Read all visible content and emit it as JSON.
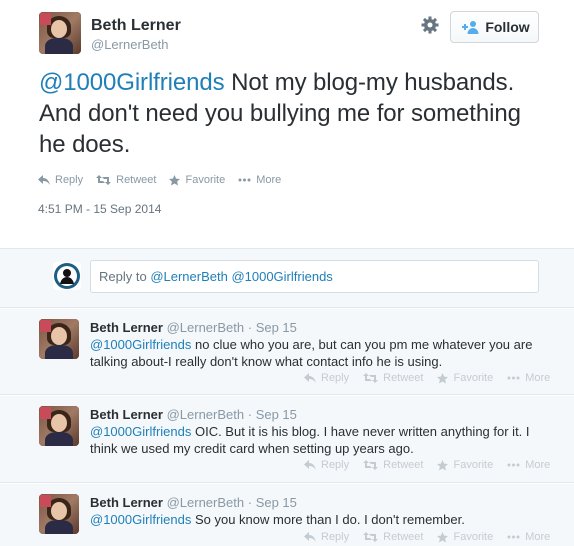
{
  "tweet": {
    "author_name": "Beth Lerner",
    "author_handle": "@LernerBeth",
    "follow_label": "Follow",
    "mention": "@1000Girlfriends",
    "text": " Not my blog-my husbands. And don't need you bullying me for something he does.",
    "actions": {
      "reply": "Reply",
      "retweet": "Retweet",
      "favorite": "Favorite",
      "more": "More"
    },
    "timestamp": "4:51 PM - 15 Sep 2014"
  },
  "reply_box": {
    "prefix": "Reply to ",
    "mentions": "@LernerBeth @1000Girlfriends"
  },
  "replies": [
    {
      "name": "Beth Lerner",
      "handle": "@LernerBeth",
      "date": "Sep 15",
      "mention": "@1000Girlfriends",
      "text": " no clue who you are, but can you pm me whatever you are talking about-I really don't know what contact info he is using."
    },
    {
      "name": "Beth Lerner",
      "handle": "@LernerBeth",
      "date": "Sep 15",
      "mention": "@1000Girlfriends",
      "text": " OIC. But it is his blog. I have never written anything for it. I think we used my credit card when setting up years ago."
    },
    {
      "name": "Beth Lerner",
      "handle": "@LernerBeth",
      "date": "Sep 15",
      "mention": "@1000Girlfriends",
      "text": " So you know more than I do. I don't remember."
    }
  ],
  "reply_actions": {
    "reply": "Reply",
    "retweet": "Retweet",
    "favorite": "Favorite",
    "more": "More"
  },
  "sep": " · ",
  "colors": {
    "link": "#1f7fb8",
    "muted": "#8899a6",
    "text": "#292f33",
    "thread_bg": "#f5f8fa"
  }
}
